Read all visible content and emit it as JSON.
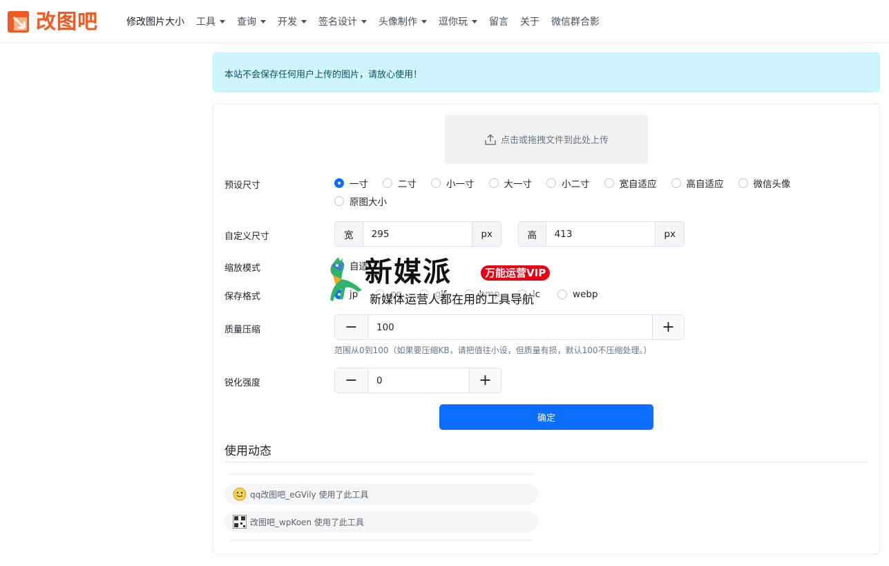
{
  "brand": {
    "name": "改图吧",
    "color": "#f15a24"
  },
  "nav": {
    "items": [
      {
        "label": "修改图片大小",
        "dropdown": false,
        "active": true
      },
      {
        "label": "工具",
        "dropdown": true
      },
      {
        "label": "查询",
        "dropdown": true
      },
      {
        "label": "开发",
        "dropdown": true
      },
      {
        "label": "签名设计",
        "dropdown": true
      },
      {
        "label": "头像制作",
        "dropdown": true
      },
      {
        "label": "逗你玩",
        "dropdown": true
      },
      {
        "label": "留言",
        "dropdown": false
      },
      {
        "label": "关于",
        "dropdown": false
      },
      {
        "label": "微信群合影",
        "dropdown": false
      }
    ]
  },
  "alert": {
    "text": "本站不会保存任何用户上传的图片，请放心使用！"
  },
  "upload": {
    "label": "点击或拖拽文件到此处上传",
    "icon": "upload-icon"
  },
  "preset": {
    "label": "预设尺寸",
    "options": [
      "一寸",
      "二寸",
      "小一寸",
      "大一寸",
      "小二寸",
      "宽自适应",
      "高自适应",
      "微信头像",
      "原图大小"
    ],
    "selected": "一寸"
  },
  "custom": {
    "label": "自定义尺寸",
    "width_label": "宽",
    "width_value": "295",
    "width_unit": "px",
    "height_label": "高",
    "height_value": "413",
    "height_unit": "px"
  },
  "scale": {
    "label": "缩放模式",
    "option_visible": "自适"
  },
  "format": {
    "label": "保存格式",
    "options_visible": [
      "jp",
      "pn",
      "gif",
      "bmp",
      "ic",
      "webp"
    ]
  },
  "quality": {
    "label": "质量压缩",
    "value": "100",
    "minus": "−",
    "plus": "+",
    "hint": "范围从0到100（如果要压缩KB，请把值往小设，但质量有损，默认100不压缩处理。）"
  },
  "sharpen": {
    "label": "锐化强度",
    "value": "0",
    "minus": "−",
    "plus": "+"
  },
  "submit": {
    "label": "确定",
    "color": "#0d6efd"
  },
  "activity": {
    "title": "使用动态",
    "items": [
      {
        "text": "qq改图吧_eGVily 使用了此工具",
        "avatar": "smiley-avatar"
      },
      {
        "text": "改图吧_wpKoen 使用了此工具",
        "avatar": "qrcode-avatar"
      }
    ]
  },
  "watermark": {
    "title": "新媒派",
    "badge": "万能运营VIP",
    "subtitle": "新媒体运营人都在用的工具导航"
  }
}
